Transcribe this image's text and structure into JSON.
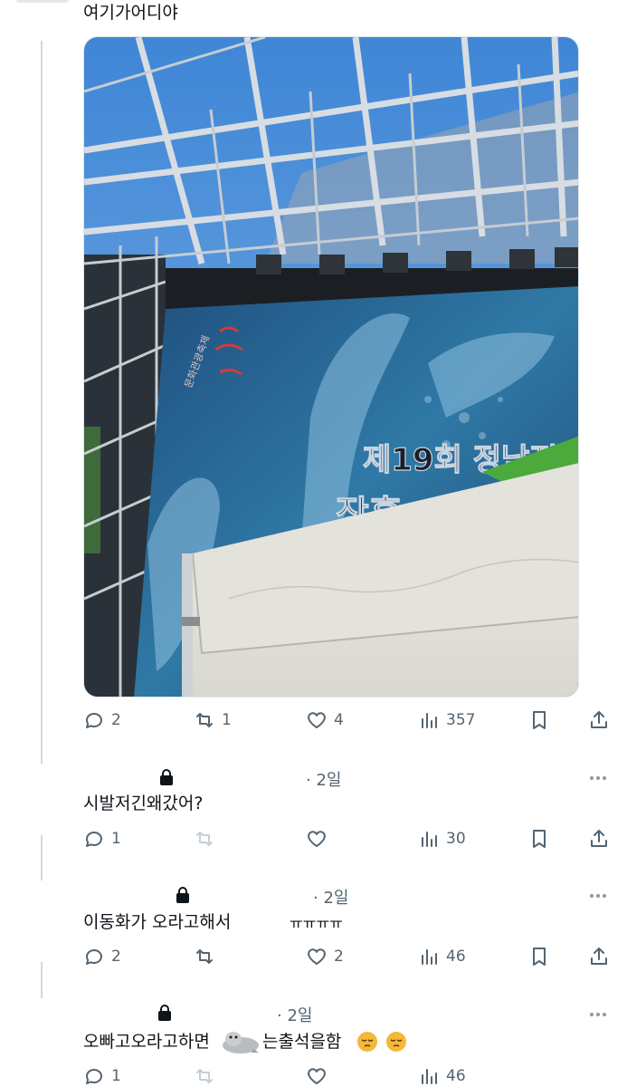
{
  "main_post": {
    "text": "여기가어디야",
    "stats": {
      "replies": "2",
      "reposts": "1",
      "likes": "4",
      "views": "357"
    }
  },
  "replies": [
    {
      "time": "· 2일",
      "text": "시발저긴왜갔어?",
      "stats": {
        "replies": "1",
        "reposts": "",
        "likes": "",
        "views": "30"
      }
    },
    {
      "time": "· 2일",
      "text_part1": "이동화가 오라고해서",
      "text_part2": "ㅠㅠㅠㅠ",
      "stats": {
        "replies": "2",
        "reposts": "",
        "likes": "2",
        "views": "46"
      }
    },
    {
      "time": "· 2일",
      "text_part1": "오빠고오라고하면",
      "text_part2": "는출석을함",
      "stats": {
        "replies": "1",
        "reposts": "",
        "likes": "",
        "views": "46"
      }
    }
  ],
  "media": {
    "banner_text_line1": "제19회 정남진",
    "banner_text_line2": "장흥",
    "logo_text": "문화관광축제"
  },
  "colors": {
    "secondary_text": "#536471",
    "thread_line": "#cfd9de",
    "sky": "#4d8fd6",
    "screen_blue": "#2a5d8f",
    "tent": "#e9e8e2"
  },
  "icons": [
    "reply-icon",
    "repost-icon",
    "like-icon",
    "views-icon",
    "bookmark-icon",
    "share-icon",
    "lock-icon",
    "more-icon",
    "seal-emoji",
    "sleepy-face-emoji"
  ]
}
